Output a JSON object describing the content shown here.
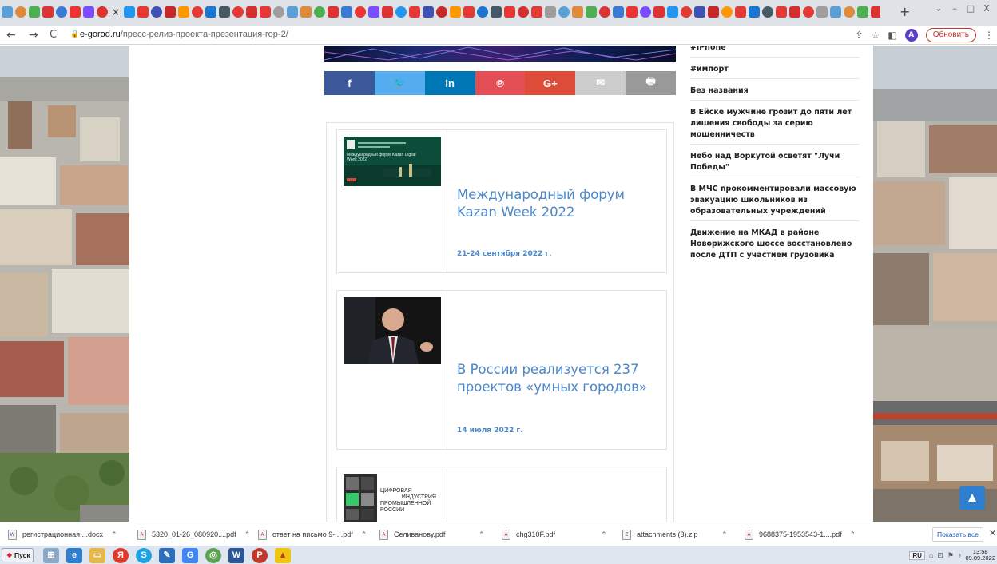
{
  "browser": {
    "url_domain": "e-gorod.ru",
    "url_path": "/пресс-релиз-проекта-презентация-гор-2/",
    "update_label": "Обновить",
    "avatar_letter": "A",
    "new_tab": "+",
    "tab_close": "×",
    "back": "←",
    "forward": "→",
    "reload": "C",
    "lock": "🔒",
    "win_min": "⌄",
    "win_restore": "□",
    "win_close": "X"
  },
  "share": {
    "facebook": "f",
    "twitter": "🐦",
    "linkedin": "in",
    "pinterest": "℗",
    "googleplus": "G+",
    "email": "✉",
    "print": "🖶",
    "colors": [
      "#3b5998",
      "#55acee",
      "#0077b5",
      "#e34e55",
      "#dd4b39",
      "#cccccc",
      "#999999"
    ]
  },
  "cards": [
    {
      "title": "Международный форум Kazan Week 2022",
      "date": "21-24 сентября 2022 г.",
      "thumb_caption": "Международный форум Kazan Digital Week 2022"
    },
    {
      "title": "В России реализуется 237 проектов «умных городов»",
      "date": "14 июля 2022 г."
    },
    {
      "thumb_lines": [
        "ЦИФРОВАЯ",
        "ИНДУСТРИЯ",
        "ПРОМЫШЛЕННОЙ",
        "РОССИИ"
      ]
    }
  ],
  "sidebar": [
    "#iPhone",
    "#импорт",
    "Без названия",
    "В Ейске мужчине грозит до пяти лет лишения свободы за серию мошенничеств",
    "Небо над Воркутой осветят \"Лучи Победы\"",
    "В МЧС прокомментировали массовую эвакуацию школьников из образовательных учреждений",
    "Движение на МКАД в районе Новорижского шоссе восстановлено после ДТП с участием грузовика"
  ],
  "downloads": [
    "регистрационная....docx",
    "5320_01-26_080920....pdf",
    "ответ на письмо 9-....pdf",
    "Селиванову.pdf",
    "chg310F.pdf",
    "attachments (3).zip",
    "9688375-1953543-1....pdf"
  ],
  "downloads_show_all": "Показать все",
  "downloads_close": "✕",
  "taskbar": {
    "start": "Пуск",
    "lang": "RU",
    "time": "13:58",
    "date": "09.09.2022"
  },
  "scroll_top_icon": "chevron-up"
}
